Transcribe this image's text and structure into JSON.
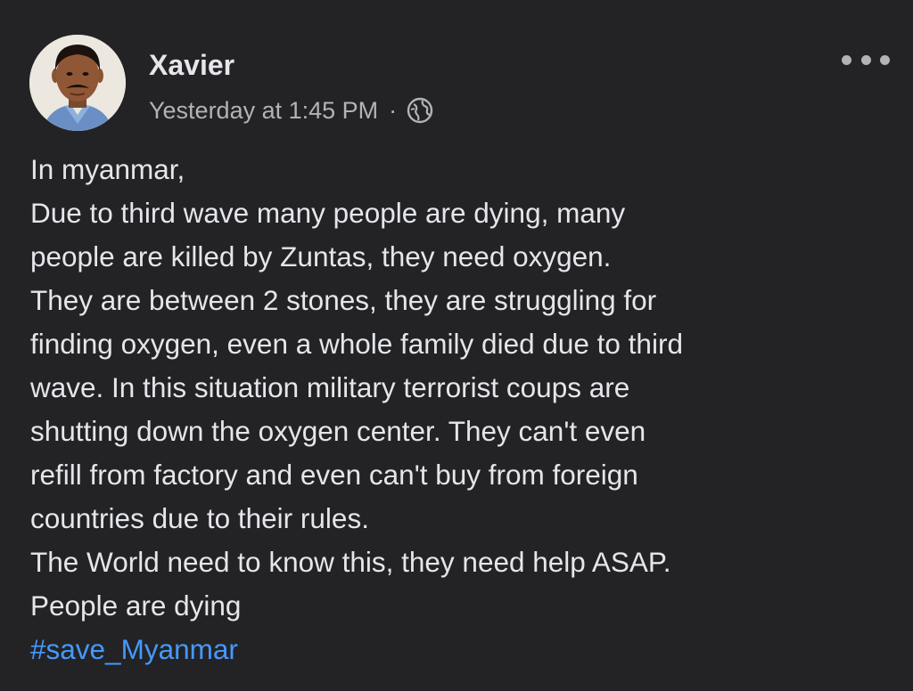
{
  "post": {
    "author": "Xavier",
    "timestamp": "Yesterday at 1:45 PM",
    "separator": "·",
    "audience_icon": "globe-icon",
    "menu_icon": "more-horizontal-icon",
    "body_lines": [
      "In myanmar,",
      "Due to third wave many people are dying, many",
      "people are killed by Zuntas, they need oxygen.",
      "They are between 2 stones, they are struggling for",
      "finding oxygen, even a whole family died due to third",
      "wave. In this situation military terrorist coups are",
      "shutting down the oxygen center. They can't even",
      "refill from factory and even can't buy from foreign",
      "countries due to their rules.",
      "The World need to know this, they need help ASAP.",
      "People are dying"
    ],
    "hashtag": "#save_Myanmar"
  },
  "colors": {
    "background": "#232325",
    "text": "#e4e6eb",
    "secondary_text": "#b0b3b8",
    "link": "#4599ff"
  }
}
